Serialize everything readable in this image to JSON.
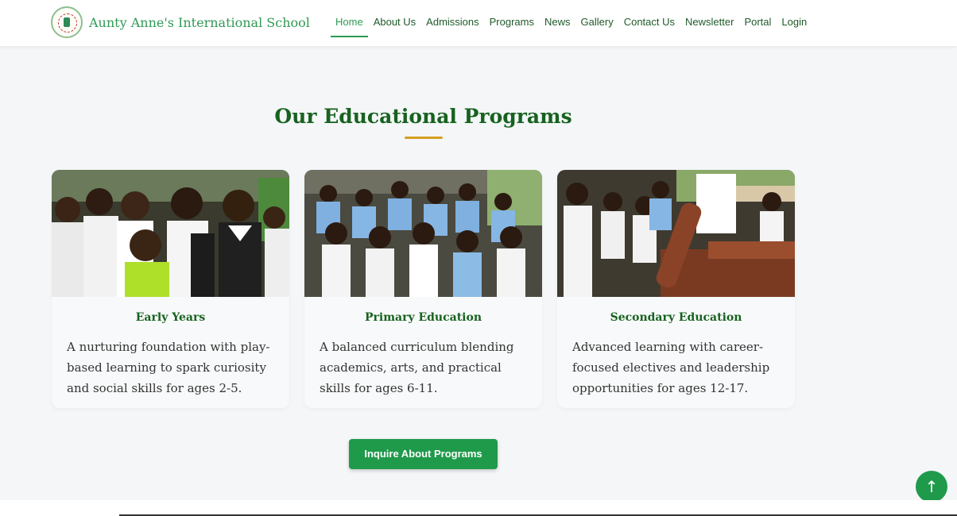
{
  "brand": {
    "name": "Aunty Anne's International School",
    "logo_icon": "school-crest-icon"
  },
  "nav": {
    "items": [
      {
        "label": "Home",
        "active": true
      },
      {
        "label": "About Us"
      },
      {
        "label": "Admissions"
      },
      {
        "label": "Programs"
      },
      {
        "label": "News"
      },
      {
        "label": "Gallery"
      },
      {
        "label": "Contact Us"
      },
      {
        "label": "Newsletter"
      },
      {
        "label": "Portal"
      },
      {
        "label": "Login"
      }
    ]
  },
  "programs": {
    "title": "Our Educational Programs",
    "cards": [
      {
        "title": "Early Years",
        "description": "A nurturing foundation with play-based learning to spark curiosity and social skills for ages 2-5."
      },
      {
        "title": "Primary Education",
        "description": "A balanced curriculum blending academics, arts, and practical skills for ages 6-11."
      },
      {
        "title": "Secondary Education",
        "description": "Advanced learning with career-focused electives and leadership opportunities for ages 12-17."
      }
    ],
    "cta_label": "Inquire About Programs"
  },
  "scroll_top": {
    "icon": "arrow-up-icon",
    "glyph": "↑"
  },
  "colors": {
    "brand_green": "#1f9a4b",
    "heading_green": "#17621f",
    "accent_gold": "#d4a020"
  }
}
